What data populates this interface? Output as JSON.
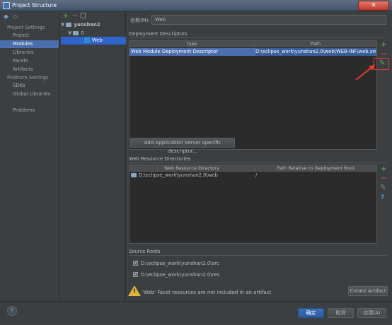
{
  "window": {
    "title": "Project Structure",
    "close_label": "✕"
  },
  "sidebar": {
    "project_settings_header": "Project Settings",
    "project_settings_items": [
      {
        "label": "Project"
      },
      {
        "label": "Modules"
      },
      {
        "label": "Libraries"
      },
      {
        "label": "Facets"
      },
      {
        "label": "Artifacts"
      }
    ],
    "platform_settings_header": "Platform Settings",
    "platform_settings_items": [
      {
        "label": "SDKs"
      },
      {
        "label": "Global Libraries"
      }
    ],
    "problems_label": "Problems",
    "selected": "Modules"
  },
  "tree": {
    "nodes": [
      {
        "label": "yunshan2"
      },
      {
        "label": "0"
      },
      {
        "label": "Web"
      }
    ]
  },
  "facet": {
    "name_label": "名称(M):",
    "name_value": "Web",
    "deployment_descriptors": {
      "title": "Deployment Descriptors",
      "columns": [
        "Type",
        "Path"
      ],
      "rows": [
        {
          "type": "Web Module Deployment Descriptor",
          "path": "D:\\eclipse_work\\yunshan2.0\\web\\WEB-INF\\web.xml"
        }
      ],
      "add_server_button": "Add Application Server specific descriptor..."
    },
    "web_resource_directories": {
      "title": "Web Resource Directories",
      "columns": [
        "Web Resource Directory",
        "Path Relative to Deployment Root"
      ],
      "rows": [
        {
          "directory": "D:\\eclipse_work\\yunshan2.0\\web",
          "relative": "/"
        }
      ]
    },
    "source_roots": {
      "title": "Source Roots",
      "items": [
        {
          "path": "D:\\eclipse_work\\yunshan2.0\\src",
          "checked": true
        },
        {
          "path": "D:\\eclipse_work\\yunshan2.0\\res",
          "checked": true
        }
      ]
    },
    "warning": {
      "text": "'Web' Facet resources are not included in an artifact",
      "create_artifact_button": "Create Artifact"
    }
  },
  "footer": {
    "ok": "确定",
    "cancel": "取消",
    "apply": "应用(A)",
    "help": "?"
  },
  "colors": {
    "background": "#3c3f41",
    "selection": "#4b6eaf",
    "accent_add": "#5aa64a",
    "accent_remove": "#c94d44",
    "annotation_red": "#e03c31"
  }
}
